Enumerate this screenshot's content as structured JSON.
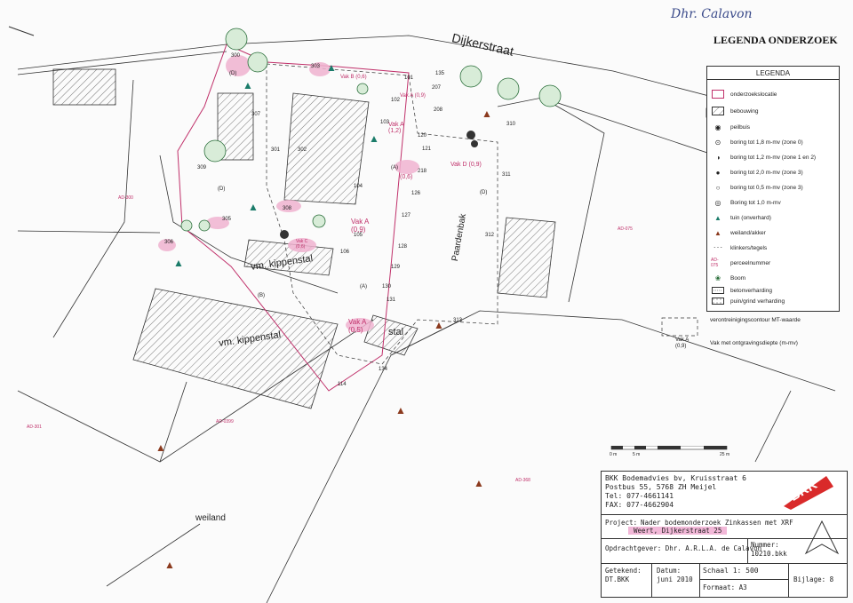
{
  "header": {
    "handwritten_note": "Dhr. Calavon"
  },
  "legend": {
    "title": "LEGENDA ONDERZOEK",
    "box_header": "LEGENDA",
    "items": [
      {
        "symbol": "rect-outline-red",
        "label": "onderzoekslocatie"
      },
      {
        "symbol": "hatch",
        "label": "bebouwing"
      },
      {
        "symbol": "peilbuis",
        "label": "peilbuis"
      },
      {
        "symbol": "dot-ring",
        "label": "boring tot 1,8 m-mv (zone 0)"
      },
      {
        "symbol": "half-dot",
        "label": "boring tot 1,2 m-mv (zone 1 en 2)"
      },
      {
        "symbol": "full-dot",
        "label": "boring tot 2,0 m-mv (zone 3)"
      },
      {
        "symbol": "open-dot",
        "label": "boring tot 0,5 m-mv (zone 3)"
      },
      {
        "symbol": "double-ring",
        "label": "Boring tot 1,0 m-mv"
      },
      {
        "symbol": "green-plant",
        "label": "tuin (onverhard)"
      },
      {
        "symbol": "brown-plant",
        "label": "weiland/akker"
      },
      {
        "symbol": "dash-line",
        "label": "klinkers/tegels"
      },
      {
        "symbol": "perceel",
        "code": "AD-075",
        "label": "perceelnummer"
      },
      {
        "symbol": "tree",
        "label": "Boom"
      },
      {
        "symbol": "beton",
        "label": "betonverharding"
      },
      {
        "symbol": "puin",
        "label": "puin/grind verharding"
      }
    ],
    "contour_label": "verontreinigingscontour MT-waarde",
    "vak_symbol": "Vak A\n(0,9)",
    "vak_label": "Vak met ontgravingsdiepte (m-mv)"
  },
  "map": {
    "street": "Dijkerstraat",
    "side_street": "Paardenbak",
    "labels": {
      "kippenstal_1": "vm. kippenstal",
      "kippenstal_2": "vm. kippenstal",
      "stal": "stal",
      "weiland": "weiland"
    },
    "parcels": [
      "AD-300",
      "AD-075",
      "AD-0399",
      "AD-301",
      "AD-368"
    ],
    "vakken": [
      {
        "name": "Vak B",
        "depth": "(0,6)"
      },
      {
        "name": "Vak B",
        "depth": "(0,6)"
      },
      {
        "name": "Vak A",
        "depth": "(0,9)"
      },
      {
        "name": "Vak A",
        "depth": "(1,2)"
      },
      {
        "name": "Vak D",
        "depth": "(0,9)"
      },
      {
        "name": "Vak D",
        "depth": "(0,6)"
      },
      {
        "name": "Vak A",
        "depth": "(0,9)"
      },
      {
        "name": "Vak C",
        "depth": "(0,6)"
      },
      {
        "name": "Vak A",
        "depth": "(0,5)"
      }
    ],
    "zone_letters": [
      "(D)",
      "(D)",
      "(A)",
      "(D)",
      "(B)",
      "(A)",
      "(A)",
      "(A)"
    ],
    "borings": [
      "300",
      "301",
      "302",
      "303",
      "304",
      "305",
      "306",
      "307",
      "308",
      "309",
      "310",
      "311",
      "312",
      "313",
      "101",
      "102",
      "103",
      "104",
      "105",
      "106",
      "107",
      "108",
      "109",
      "110",
      "111",
      "112",
      "113",
      "114",
      "115",
      "116",
      "117",
      "118",
      "119",
      "120",
      "121",
      "122",
      "123",
      "124",
      "125",
      "126",
      "127",
      "128",
      "129",
      "130",
      "131",
      "132",
      "133",
      "134",
      "135",
      "200",
      "201",
      "202",
      "203",
      "204",
      "205",
      "206",
      "207",
      "208",
      "209",
      "210",
      "211",
      "212",
      "213",
      "214",
      "215",
      "216",
      "217",
      "218",
      "219",
      "220",
      "221",
      "222",
      "223"
    ]
  },
  "scale": {
    "labels": [
      "0 m",
      "5 m",
      "25 m"
    ]
  },
  "titleblock": {
    "company": "BKK Bodemadvies bv, Kruisstraat 6",
    "address": "Postbus 55, 5768 ZH Meijel",
    "tel": "Tel:  077-4661141",
    "fax": "FAX: 077-4662904",
    "project_label": "Project:",
    "project_line1": "Nader bodemonderzoek Zinkassen met XRF",
    "project_line2": "Weert, Dijkerstraat 25",
    "client": "Opdrachtgever: Dhr. A.R.L.A. de Calavon",
    "nummer_label": "Nummer:",
    "nummer": "10210.bkk",
    "getekend_label": "Getekend:",
    "getekend": "DT.BKK",
    "datum_label": "Datum:",
    "datum": "juni 2010",
    "schaal": "Schaal   1: 500",
    "formaat": "Formaat: A3",
    "bijlage": "Bijlage: 8",
    "logo_text": "BKK",
    "logo_sub": "bodemadvies"
  }
}
